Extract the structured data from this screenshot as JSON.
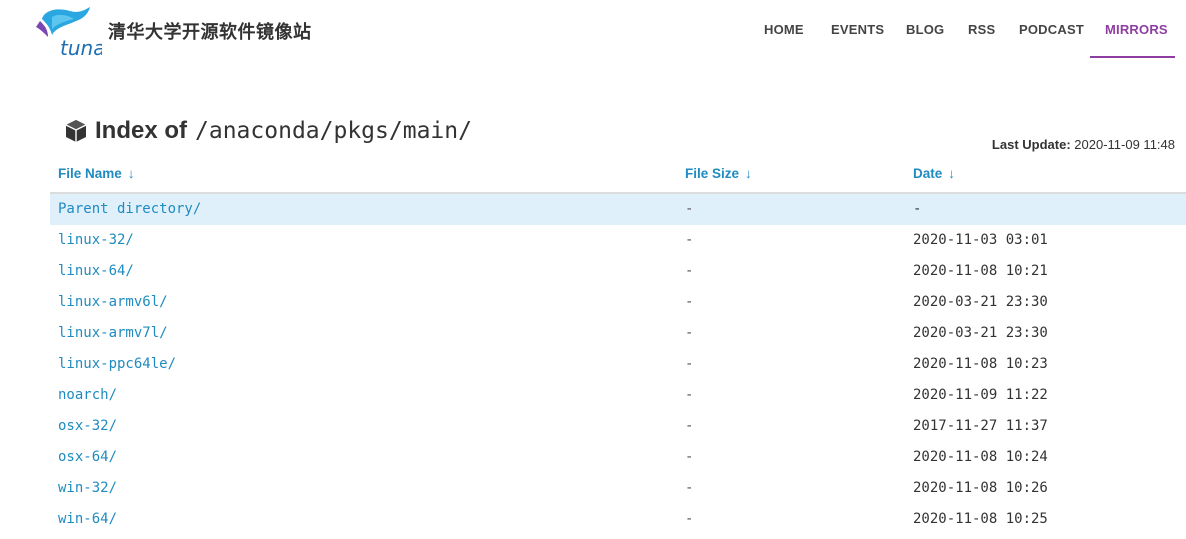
{
  "header": {
    "site_title": "清华大学开源软件镜像站",
    "logo_text": "tuna",
    "nav": [
      {
        "label": "HOME"
      },
      {
        "label": "EVENTS"
      },
      {
        "label": "BLOG"
      },
      {
        "label": "RSS"
      },
      {
        "label": "PODCAST"
      },
      {
        "label": "MIRRORS",
        "active": true
      }
    ],
    "accent_color": "#8e3ea0"
  },
  "main": {
    "heading_prefix": "Index of",
    "heading_path": "/anaconda/pkgs/main/",
    "last_update_label": "Last Update:",
    "last_update_value": "2020-11-09 11:48",
    "columns": [
      {
        "label": "File Name",
        "arrow": "↓"
      },
      {
        "label": "File Size",
        "arrow": "↓"
      },
      {
        "label": "Date",
        "arrow": "↓"
      }
    ],
    "rows": [
      {
        "name": "Parent directory/",
        "size": "-",
        "date": "-"
      },
      {
        "name": "linux-32/",
        "size": "-",
        "date": "2020-11-03 03:01"
      },
      {
        "name": "linux-64/",
        "size": "-",
        "date": "2020-11-08 10:21"
      },
      {
        "name": "linux-armv6l/",
        "size": "-",
        "date": "2020-03-21 23:30"
      },
      {
        "name": "linux-armv7l/",
        "size": "-",
        "date": "2020-03-21 23:30"
      },
      {
        "name": "linux-ppc64le/",
        "size": "-",
        "date": "2020-11-08 10:23"
      },
      {
        "name": "noarch/",
        "size": "-",
        "date": "2020-11-09 11:22"
      },
      {
        "name": "osx-32/",
        "size": "-",
        "date": "2017-11-27 11:37"
      },
      {
        "name": "osx-64/",
        "size": "-",
        "date": "2020-11-08 10:24"
      },
      {
        "name": "win-32/",
        "size": "-",
        "date": "2020-11-08 10:26"
      },
      {
        "name": "win-64/",
        "size": "-",
        "date": "2020-11-08 10:25"
      }
    ],
    "link_color": "#1f8bc0",
    "highlight_color": "#dff0fa"
  }
}
